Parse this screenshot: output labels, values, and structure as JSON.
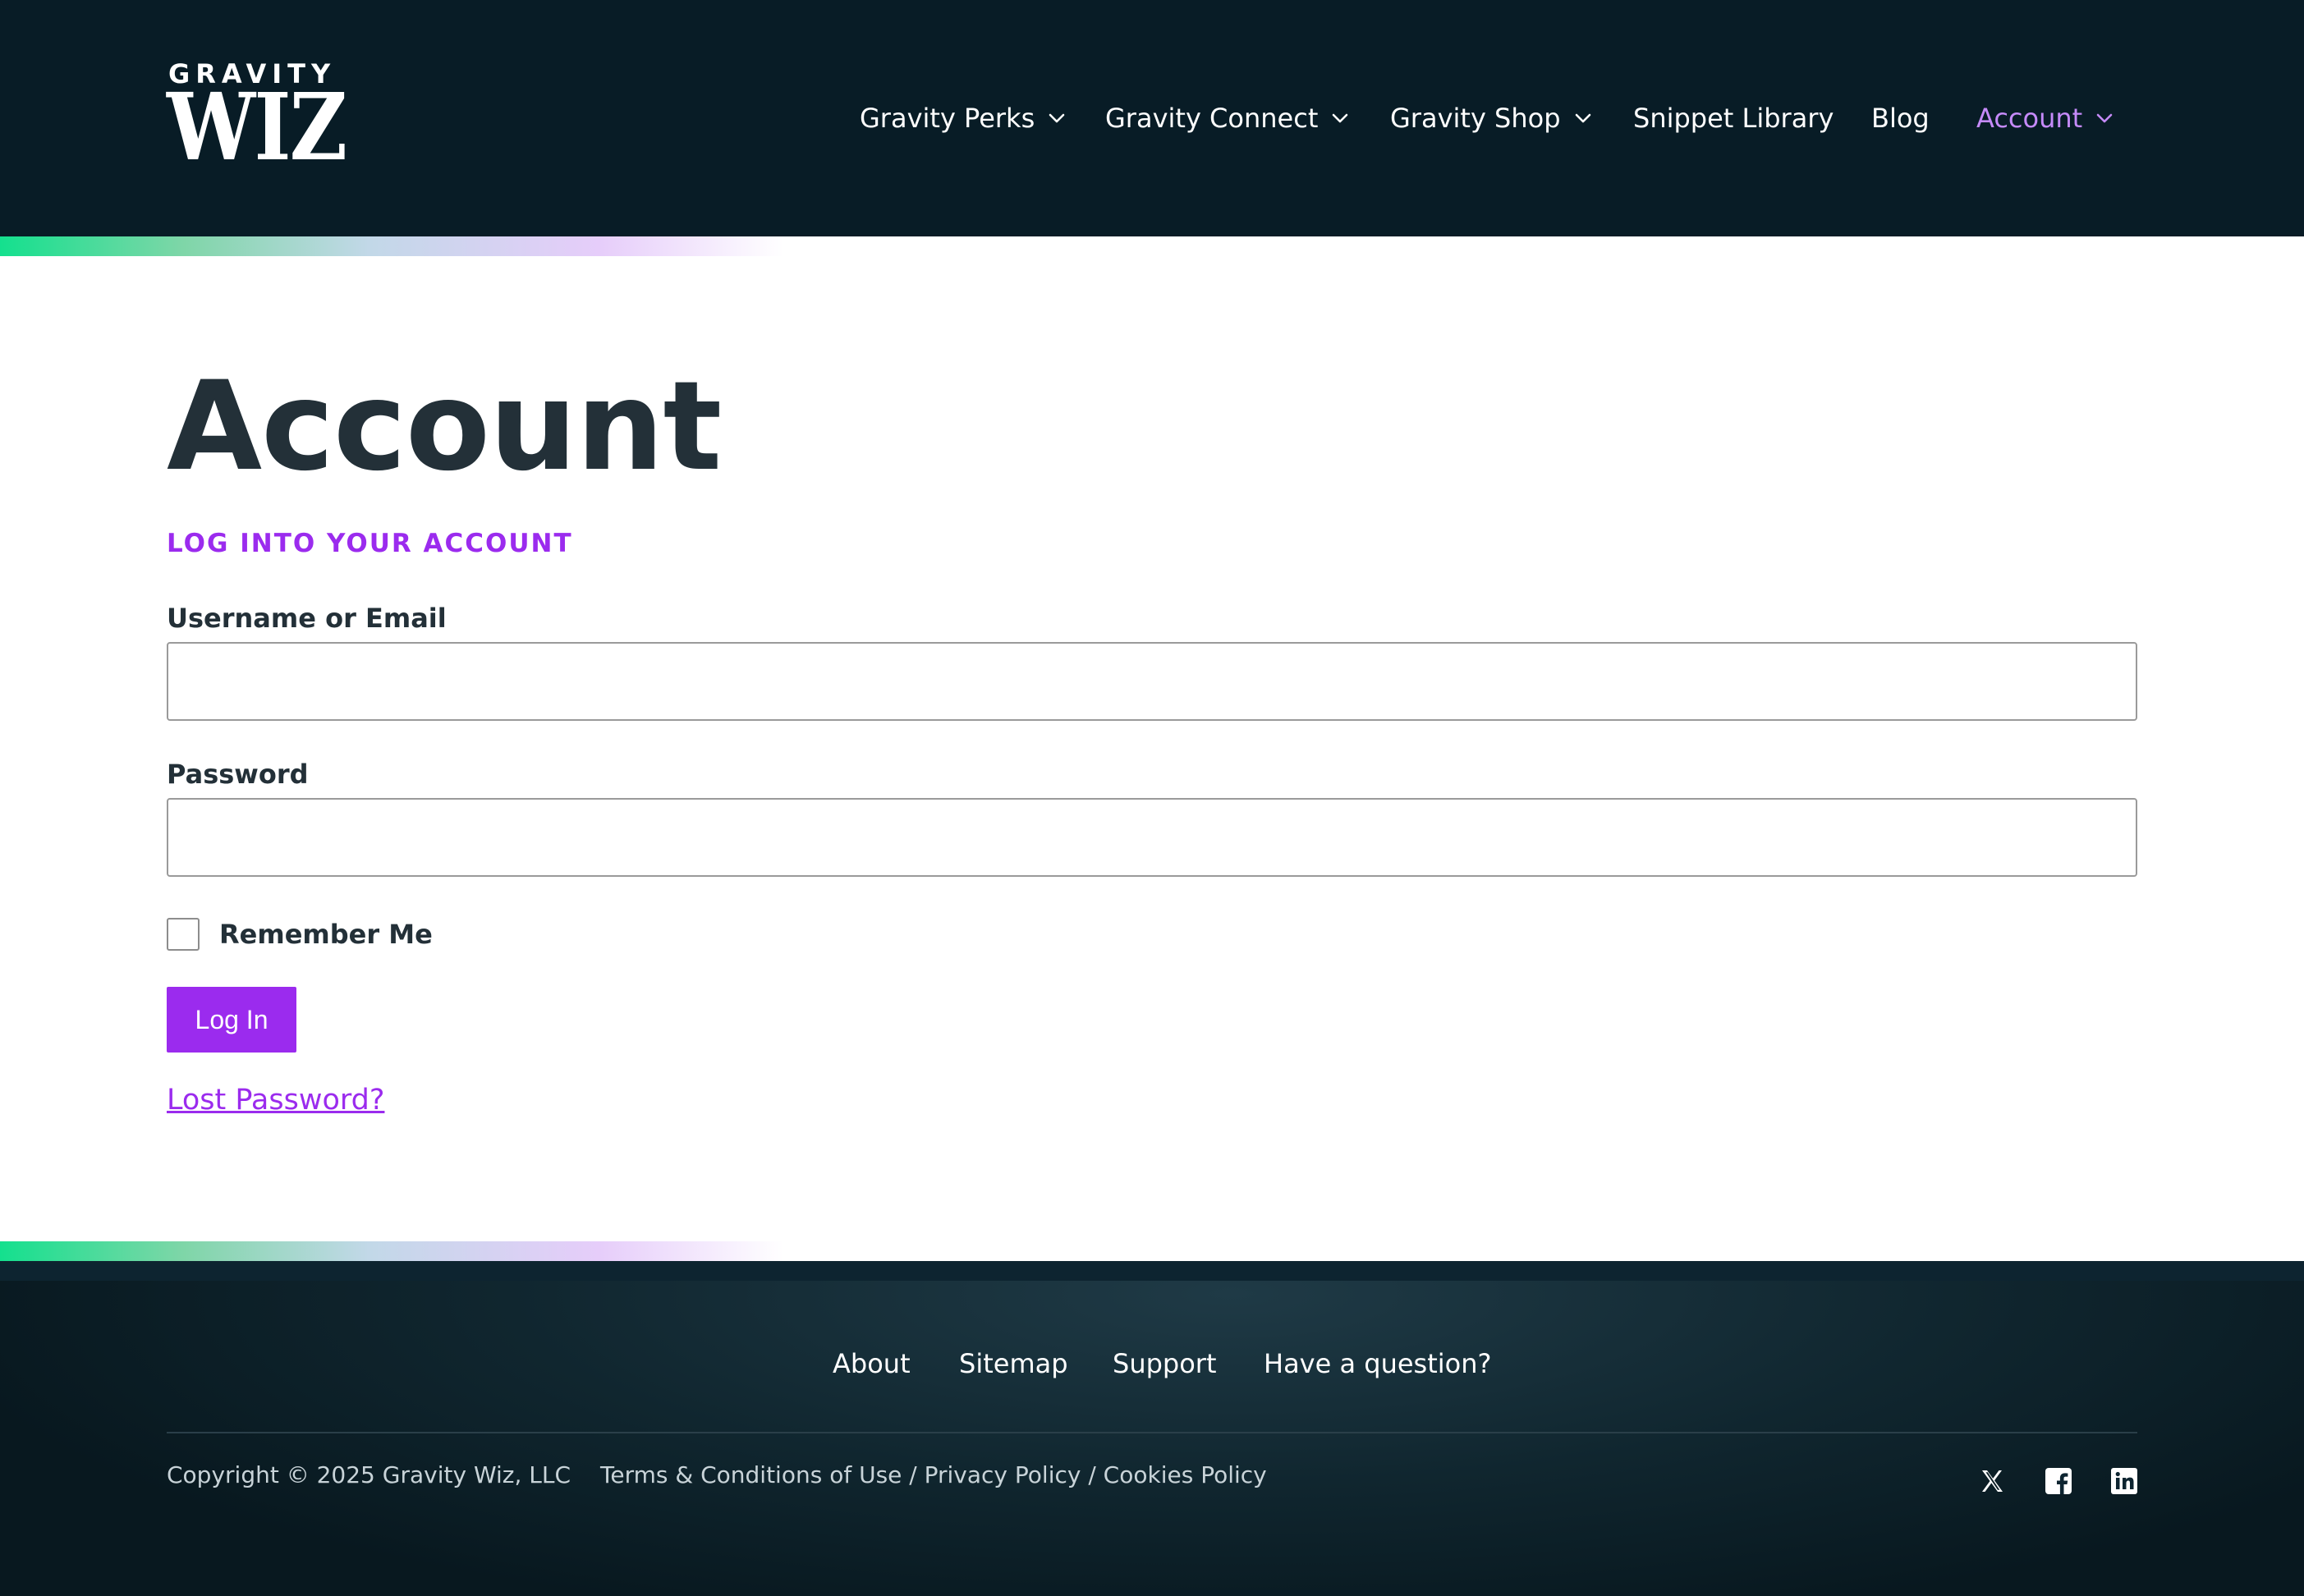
{
  "brand": {
    "logo_top": "GRAVITY",
    "logo_main": "WIZ"
  },
  "nav": {
    "items": [
      {
        "label": "Gravity Perks",
        "has_dropdown": true
      },
      {
        "label": "Gravity Connect",
        "has_dropdown": true
      },
      {
        "label": "Gravity Shop",
        "has_dropdown": true
      },
      {
        "label": "Snippet Library",
        "has_dropdown": false
      },
      {
        "label": "Blog",
        "has_dropdown": false
      },
      {
        "label": "Account",
        "has_dropdown": true,
        "active": true
      }
    ]
  },
  "main": {
    "title": "Account",
    "section_title": "LOG INTO YOUR ACCOUNT",
    "username": {
      "label": "Username or Email",
      "value": ""
    },
    "password": {
      "label": "Password",
      "value": ""
    },
    "remember_label": "Remember Me",
    "remember_checked": false,
    "login_label": "Log In",
    "lost_password": "Lost Password?"
  },
  "footer": {
    "links": [
      "About",
      "Sitemap",
      "Support",
      "Have a question?"
    ],
    "copyright": "Copyright © 2025 Gravity Wiz, LLC",
    "legal": "Terms & Conditions of Use / Privacy Policy / Cookies Policy",
    "social_icons": [
      "x-icon",
      "facebook-icon",
      "linkedin-icon"
    ]
  },
  "colors": {
    "header_bg": "#081c26",
    "accent_purple": "#9b2bee",
    "active_nav": "#c58af9",
    "text_dark": "#233038",
    "stripe_green": "#14e08e"
  }
}
